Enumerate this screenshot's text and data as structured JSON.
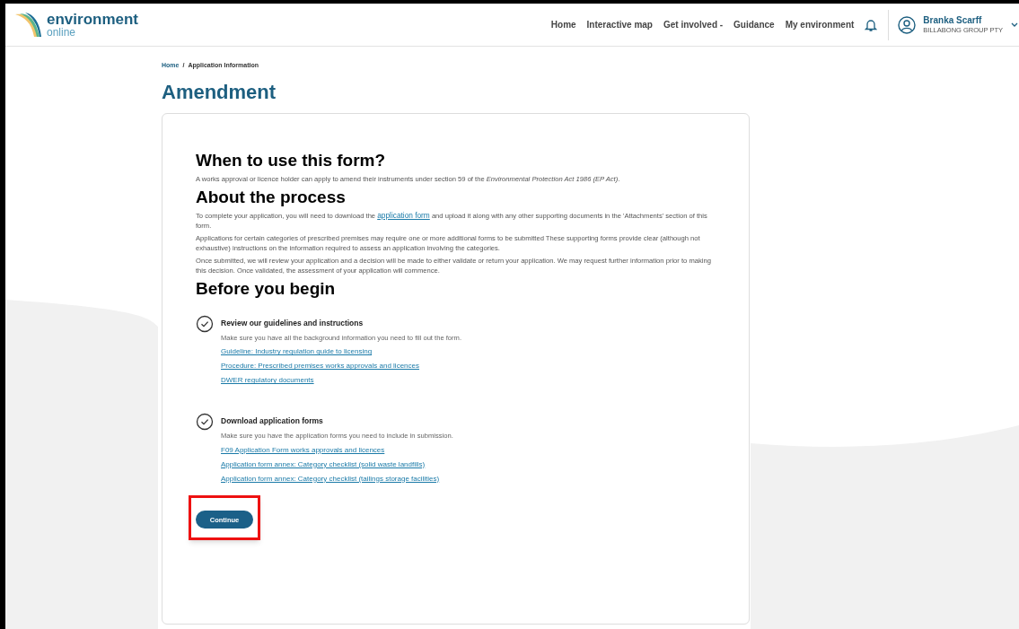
{
  "header": {
    "logo": {
      "line1": "environment",
      "line2": "online"
    },
    "nav": [
      {
        "label": "Home"
      },
      {
        "label": "Interactive map"
      },
      {
        "label": "Get involved -"
      },
      {
        "label": "Guidance"
      },
      {
        "label": "My environment"
      }
    ],
    "user": {
      "name": "Branka Scarff",
      "org": "BILLABONG GROUP PTY"
    }
  },
  "breadcrumb": [
    {
      "label": "Home"
    },
    {
      "label": "Application Information"
    }
  ],
  "breadcrumb_separator": "/",
  "page_title": "Amendment",
  "sections": [
    {
      "heading": "When to use this form?",
      "paragraphs": [
        {
          "parts": [
            {
              "kind": "text",
              "text": "A works approval or licence holder can apply to amend their instruments under section 59 of the *Environmental Protection Act 1986 (EP Act)*."
            }
          ]
        }
      ]
    },
    {
      "heading": "About the process",
      "paragraphs": [
        {
          "parts": [
            {
              "kind": "text",
              "text": "To complete your application, you will need to download the "
            },
            {
              "kind": "link",
              "text": "application form"
            },
            {
              "kind": "text",
              "text": " and upload it along with any other supporting documents in the 'Attachments' section of this form."
            }
          ]
        },
        {
          "parts": [
            {
              "kind": "text",
              "text": "Applications for certain categories of prescribed premises may require one or more additional forms to be submitted These supporting forms provide clear (although not exhaustive) instructions on the information required to assess an application involving the categories."
            }
          ]
        },
        {
          "parts": [
            {
              "kind": "text",
              "text": "Once submitted, we will review your application and a decision will be made to either validate or return your application. We may request further information prior to making this decision. Once validated, the assessment of your application will commence."
            }
          ]
        }
      ]
    },
    {
      "heading": "Before you begin"
    }
  ],
  "steps": [
    {
      "title": "Review our guidelines and instructions",
      "checked": true,
      "description": "Make sure you have all the background information you need to fill out the form.",
      "links": [
        "Guideline: Industry regulation guide to licensing",
        "Procedure: Prescribed premises works approvals and licences",
        "DWER regulatory documents"
      ]
    },
    {
      "title": "Download application forms",
      "checked": true,
      "description": "Make sure you have the application forms you need to include in submission.",
      "links": [
        "F09 Application Form works approvals and licences",
        "Application form annex: Category checklist (solid waste landfills)",
        "Application form annex: Category checklist (tailings storage facilities)"
      ]
    }
  ],
  "continue_button": {
    "label": "Continue",
    "highlighted": true
  }
}
